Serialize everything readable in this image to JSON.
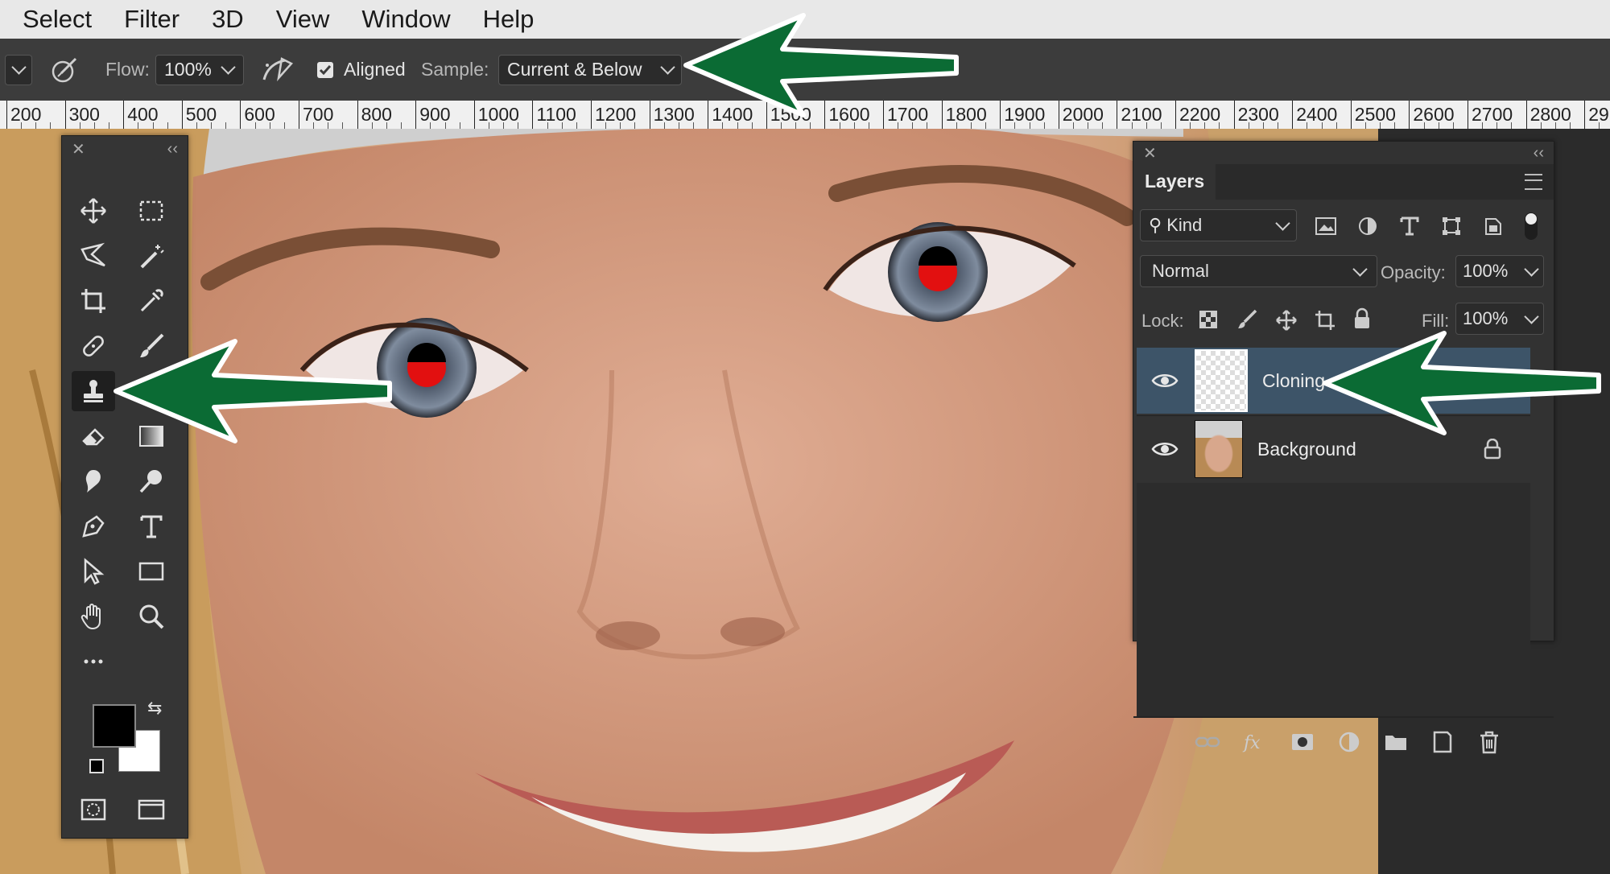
{
  "menubar": {
    "items": [
      "Select",
      "Filter",
      "3D",
      "View",
      "Window",
      "Help"
    ]
  },
  "options": {
    "flow_label": "Flow:",
    "flow_value": "100%",
    "aligned_label": "Aligned",
    "aligned_checked": true,
    "sample_label": "Sample:",
    "sample_value": "Current & Below"
  },
  "ruler": {
    "labels": [
      "200",
      "300",
      "400",
      "500",
      "600",
      "700",
      "800",
      "900",
      "1000",
      "1100",
      "1200",
      "1300",
      "1400",
      "1500",
      "1600",
      "1700",
      "1800",
      "1900",
      "2000",
      "2100",
      "2200",
      "2300",
      "2400",
      "2500",
      "2600",
      "2700",
      "2800",
      "29"
    ]
  },
  "layers_panel": {
    "tab_label": "Layers",
    "filter_label": "Kind",
    "blend_mode": "Normal",
    "opacity_label": "Opacity:",
    "opacity_value": "100%",
    "lock_label": "Lock:",
    "fill_label": "Fill:",
    "fill_value": "100%",
    "layers": [
      {
        "name": "Cloning",
        "selected": true,
        "visible": true,
        "locked": false
      },
      {
        "name": "Background",
        "selected": false,
        "visible": true,
        "locked": true
      }
    ]
  },
  "colors": {
    "annotation_arrow": "#0b6b34",
    "selected_layer": "#3d5468",
    "foreground": "#000000",
    "background": "#ffffff"
  },
  "icons": {
    "tools": [
      "move-icon",
      "marquee-icon",
      "lasso-icon",
      "magic-wand-icon",
      "crop-icon",
      "eyedropper-icon",
      "healing-brush-icon",
      "brush-icon",
      "clone-stamp-icon",
      "history-brush-icon",
      "eraser-icon",
      "gradient-icon",
      "blur-icon",
      "dodge-icon",
      "pen-icon",
      "type-icon",
      "path-selection-icon",
      "rectangle-icon",
      "hand-icon",
      "zoom-icon",
      "more-tools-icon"
    ]
  }
}
